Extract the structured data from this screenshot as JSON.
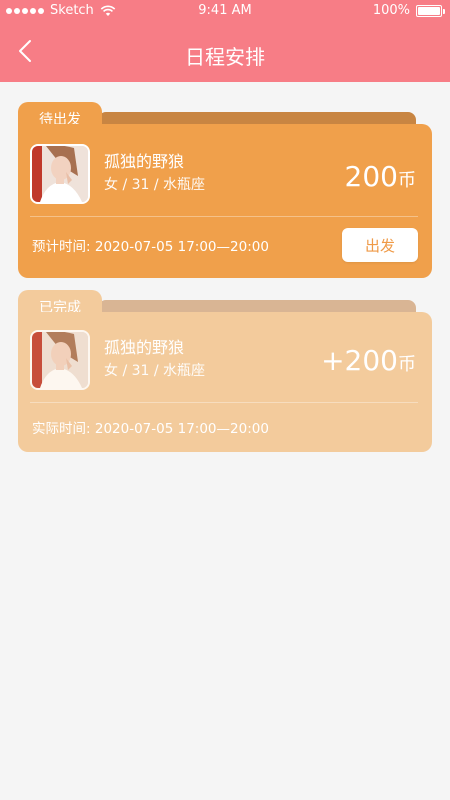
{
  "status_bar": {
    "carrier": "Sketch",
    "time": "9:41 AM",
    "battery": "100%",
    "battery_level": 1.0
  },
  "nav": {
    "title": "日程安排",
    "back_icon": "chevron-left-icon"
  },
  "colors": {
    "header": "#f77d86",
    "card_pending": "#f0a04b",
    "card_done": "#f3cb9c",
    "page_bg": "#f5f5f5"
  },
  "cards": [
    {
      "status": "待出发",
      "name": "孤独的野狼",
      "meta": "女 / 31 / 水瓶座",
      "amount": "200",
      "unit": "币",
      "time_label": "预计时间:",
      "time_value": "2020-07-05 17:00—20:00",
      "action_label": "出发"
    },
    {
      "status": "已完成",
      "name": "孤独的野狼",
      "meta": "女 / 31 / 水瓶座",
      "amount": "+200",
      "unit": "币",
      "time_label": "实际时间:",
      "time_value": "2020-07-05 17:00—20:00"
    }
  ]
}
